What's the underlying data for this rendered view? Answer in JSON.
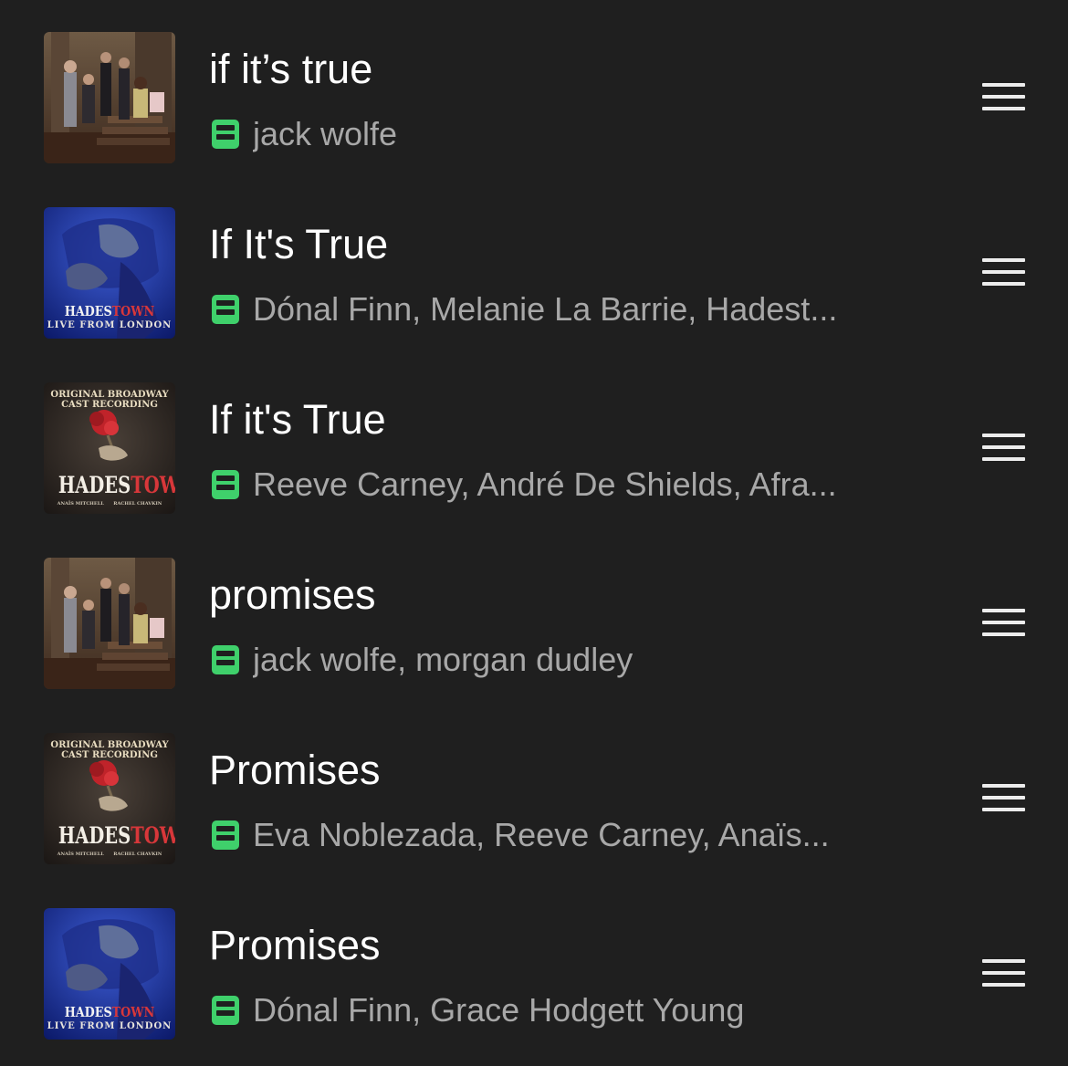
{
  "tracks": [
    {
      "title": "if it’s true",
      "artists": "jack wolfe",
      "art": {
        "style": "photo"
      }
    },
    {
      "title": "If It's True",
      "artists": "Dónal Finn, Melanie La Barrie, Hadest...",
      "art": {
        "style": "london",
        "title_a": "HADES",
        "title_b": "TOWN",
        "subtitle": "LIVE FROM LONDON"
      }
    },
    {
      "title": "If it's True",
      "artists": "Reeve Carney, André De Shields, Afra...",
      "art": {
        "style": "broadway",
        "top_line_1": "ORIGINAL BROADWAY",
        "top_line_2": "CAST RECORDING",
        "title_a": "HADES",
        "title_b": "TOWN",
        "credit_1": "ANAÏS MITCHELL",
        "credit_2": "RACHEL CHAVKIN"
      }
    },
    {
      "title": "promises",
      "artists": "jack wolfe, morgan dudley",
      "art": {
        "style": "photo"
      }
    },
    {
      "title": "Promises",
      "artists": "Eva Noblezada, Reeve Carney, Anaïs...",
      "art": {
        "style": "broadway",
        "top_line_1": "ORIGINAL BROADWAY",
        "top_line_2": "CAST RECORDING",
        "title_a": "HADES",
        "title_b": "TOWN",
        "credit_1": "ANAÏS MITCHELL",
        "credit_2": "RACHEL CHAVKIN"
      }
    },
    {
      "title": "Promises",
      "artists": "Dónal Finn, Grace Hodgett Young",
      "art": {
        "style": "london",
        "title_a": "HADES",
        "title_b": "TOWN",
        "subtitle": "LIVE FROM LONDON"
      }
    }
  ],
  "icons": {
    "source_badge": "green-list-icon",
    "reorder": "drag-handle-icon"
  },
  "colors": {
    "background": "#1f1f1f",
    "title": "#ffffff",
    "artists": "#a8a8a8",
    "badge": "#3fd06b"
  }
}
